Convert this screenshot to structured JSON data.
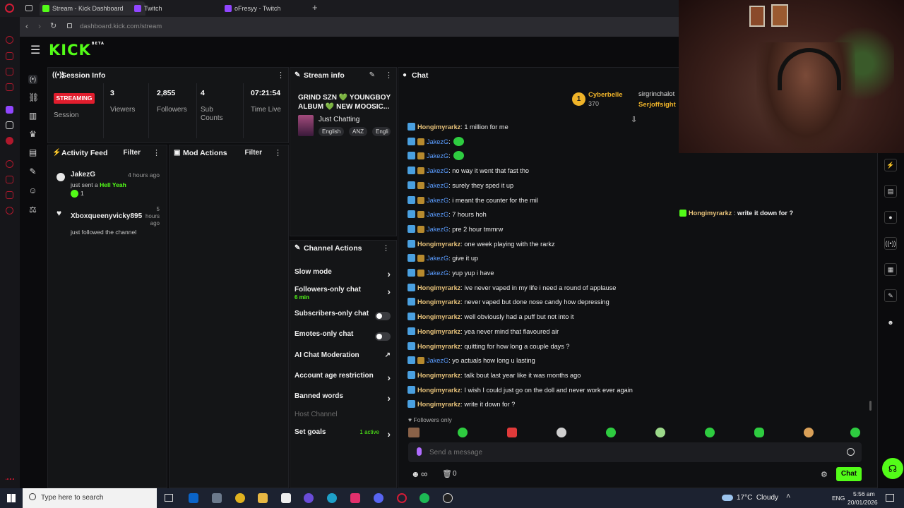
{
  "browser": {
    "tabs": [
      {
        "label": "Stream - Kick Dashboard",
        "color": "#53fc18"
      },
      {
        "label": "Twitch",
        "color": "#9146ff"
      },
      {
        "label": "oFresyy - Twitch",
        "color": "#9146ff"
      }
    ],
    "new_tab": "+",
    "url_host": "dashboard.kick.com",
    "url_path": "/stream"
  },
  "kick": {
    "logo": "KICK",
    "beta": "BETA",
    "menu_icon": "☰"
  },
  "session": {
    "title": "Session Info",
    "status": "STREAMING",
    "status_label": "Session",
    "stats": [
      {
        "value": "3",
        "label": "Viewers"
      },
      {
        "value": "2,855",
        "label": "Followers"
      },
      {
        "value": "4",
        "label": "Sub Counts"
      },
      {
        "value": "07:21:54",
        "label": "Time Live"
      }
    ]
  },
  "stream_info": {
    "title": "Stream info",
    "stream_title": "GRIND SZN 💚 YOUNGBOY ALBUM 💚 NEW MOOSIC...",
    "category": "Just Chatting",
    "tags": [
      "English",
      "ANZ",
      "Engli"
    ]
  },
  "activity": {
    "title": "Activity Feed",
    "filter": "Filter",
    "items": [
      {
        "user": "JakezG",
        "time": "4 hours ago",
        "text": "just sent a",
        "highlight": "Hell Yeah",
        "count": "1"
      },
      {
        "user": "Xboxqueenyvicky895",
        "time": "5 hours ago",
        "text": "just followed the channel"
      }
    ]
  },
  "mod": {
    "title": "Mod Actions",
    "filter": "Filter"
  },
  "channel_actions": {
    "title": "Channel Actions",
    "items": [
      {
        "label": "Slow mode"
      },
      {
        "label": "Followers-only chat",
        "sub": "6 min"
      },
      {
        "label": "Subscribers-only chat"
      },
      {
        "label": "Emotes-only chat"
      },
      {
        "label": "AI Chat Moderation"
      },
      {
        "label": "Account age restriction"
      },
      {
        "label": "Banned words"
      },
      {
        "label": "Host Channel"
      },
      {
        "label": "Set goals",
        "sub": "1 active"
      }
    ]
  },
  "chat": {
    "title": "Chat",
    "leaderboard": [
      {
        "rank": "1",
        "name": "Cyberbelle",
        "amount": "370"
      },
      {
        "name": "sirgrinchalot"
      },
      {
        "name": "Serjoffsight"
      }
    ],
    "messages": [
      {
        "user": "Hongimyrarkz",
        "text": "1 million for me",
        "type": "h"
      },
      {
        "user": "JakezG",
        "text": "",
        "type": "j",
        "emote": true
      },
      {
        "user": "JakezG",
        "text": "",
        "type": "j",
        "emote": true
      },
      {
        "user": "JakezG",
        "text": "no way it went that fast tho",
        "type": "j"
      },
      {
        "user": "JakezG",
        "text": "surely they sped it up",
        "type": "j"
      },
      {
        "user": "JakezG",
        "text": "i meant the counter for the mil",
        "type": "j"
      },
      {
        "user": "JakezG",
        "text": "7 hours hoh",
        "type": "j"
      },
      {
        "user": "JakezG",
        "text": "pre 2 hour tmmrw",
        "type": "j"
      },
      {
        "user": "Hongimyrarkz",
        "text": "one week playing with the rarkz",
        "type": "h"
      },
      {
        "user": "JakezG",
        "text": "give it up",
        "type": "j"
      },
      {
        "user": "JakezG",
        "text": "yup yup i have",
        "type": "j"
      },
      {
        "user": "Hongimyrarkz",
        "text": "ive never vaped in my life i need a round of applause",
        "type": "h"
      },
      {
        "user": "Hongimyrarkz",
        "text": "never vaped but done nose candy how depressing",
        "type": "h"
      },
      {
        "user": "Hongimyrarkz",
        "text": "well obviously had a puff but not into it",
        "type": "h"
      },
      {
        "user": "Hongimyrarkz",
        "text": "yea never mind that flavoured air",
        "type": "h"
      },
      {
        "user": "Hongimyrarkz",
        "text": "quitting for how long a couple days ?",
        "type": "h"
      },
      {
        "user": "JakezG",
        "text": "yo actuals how long u lasting",
        "type": "j"
      },
      {
        "user": "Hongimyrarkz",
        "text": "talk bout last year like it was months ago",
        "type": "h"
      },
      {
        "user": "Hongimyrarkz",
        "text": "I wish I could just go on the doll and never work ever again",
        "type": "h"
      },
      {
        "user": "Hongimyrarkz",
        "text": "write it down for ?",
        "type": "h"
      }
    ],
    "overlay_msg": {
      "user": "Hongimyrarkz",
      "text": "write it down for ?"
    },
    "followers_only": "Followers only",
    "input_placeholder": "Send a message",
    "infinity": "∞",
    "count": "0",
    "send": "Chat"
  },
  "taskbar": {
    "search": "Type here to search",
    "weather": "17°C  Cloudy",
    "lang": "ENG",
    "time": "5:56 am",
    "date": "20/01/2026"
  }
}
